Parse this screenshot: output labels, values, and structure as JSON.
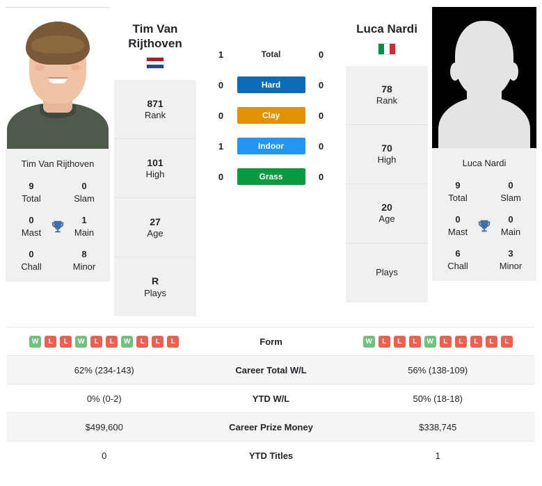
{
  "players": {
    "left": {
      "name": "Tim Van Rijthoven",
      "display_name_line1": "Tim Van",
      "display_name_line2": "Rijthoven",
      "country": "Netherlands",
      "flag_colors": [
        "#ae1c28",
        "#ffffff",
        "#21468b"
      ],
      "card_name": "Tim Van Rijthoven",
      "titles": [
        {
          "value": "9",
          "label": "Total"
        },
        {
          "value": "0",
          "label": "Slam"
        },
        {
          "value": "0",
          "label": "Mast"
        },
        {
          "value": "1",
          "label": "Main"
        },
        {
          "value": "0",
          "label": "Chall"
        },
        {
          "value": "8",
          "label": "Minor"
        }
      ],
      "profile": [
        {
          "value": "871",
          "label": "Rank"
        },
        {
          "value": "101",
          "label": "High"
        },
        {
          "value": "27",
          "label": "Age"
        },
        {
          "value": "R",
          "label": "Plays"
        }
      ]
    },
    "right": {
      "name": "Luca Nardi",
      "display_name_line1": "Luca Nardi",
      "display_name_line2": "",
      "country": "Italy",
      "flag_colors": [
        "#009246",
        "#ffffff",
        "#ce2b37"
      ],
      "card_name": "Luca Nardi",
      "titles": [
        {
          "value": "9",
          "label": "Total"
        },
        {
          "value": "0",
          "label": "Slam"
        },
        {
          "value": "0",
          "label": "Mast"
        },
        {
          "value": "0",
          "label": "Main"
        },
        {
          "value": "6",
          "label": "Chall"
        },
        {
          "value": "3",
          "label": "Minor"
        }
      ],
      "profile": [
        {
          "value": "78",
          "label": "Rank"
        },
        {
          "value": "70",
          "label": "High"
        },
        {
          "value": "20",
          "label": "Age"
        },
        {
          "value": "",
          "label": "Plays"
        }
      ]
    }
  },
  "head_to_head": [
    {
      "label": "Total",
      "left": "1",
      "right": "0",
      "color": "",
      "is_pill": false
    },
    {
      "label": "Hard",
      "left": "0",
      "right": "0",
      "color": "#0b6cb8",
      "is_pill": true
    },
    {
      "label": "Clay",
      "left": "0",
      "right": "0",
      "color": "#e09200",
      "is_pill": true
    },
    {
      "label": "Indoor",
      "left": "1",
      "right": "0",
      "color": "#2196f3",
      "is_pill": true
    },
    {
      "label": "Grass",
      "left": "0",
      "right": "0",
      "color": "#0a9b40",
      "is_pill": true
    }
  ],
  "stats_rows": [
    {
      "label": "Form",
      "type": "form",
      "left_form": [
        "W",
        "L",
        "L",
        "W",
        "L",
        "L",
        "W",
        "L",
        "L",
        "L"
      ],
      "right_form": [
        "W",
        "L",
        "L",
        "L",
        "W",
        "L",
        "L",
        "L",
        "L",
        "L"
      ],
      "shaded": false
    },
    {
      "label": "Career Total W/L",
      "type": "text",
      "left": "62% (234-143)",
      "right": "56% (138-109)",
      "shaded": true
    },
    {
      "label": "YTD W/L",
      "type": "text",
      "left": "0% (0-2)",
      "right": "50% (18-18)",
      "shaded": false
    },
    {
      "label": "Career Prize Money",
      "type": "text",
      "left": "$499,600",
      "right": "$338,745",
      "shaded": true
    },
    {
      "label": "YTD Titles",
      "type": "text",
      "left": "0",
      "right": "1",
      "shaded": false
    }
  ],
  "colors": {
    "win_badge": "#6ec27d",
    "loss_badge": "#ef5f4d",
    "card_bg": "#f0f0f0",
    "row_shaded": "#f5f5f5",
    "trophy": "#3f6fa8"
  },
  "icons": {
    "trophy": "trophy-icon"
  }
}
